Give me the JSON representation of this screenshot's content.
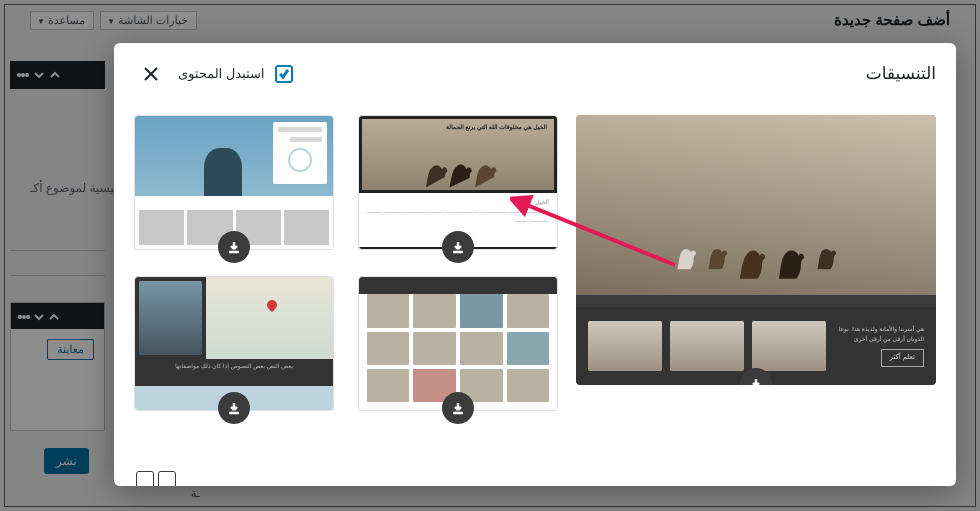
{
  "bg": {
    "page_title": "أضف صفحة جديدة",
    "screen_options": "خيارات الشاشة",
    "help": "مساعدة",
    "placeholder": "…رئيسية لموضوع أكـ",
    "preview": "معاينة",
    "publish": "نشر",
    "bottom_fragment": "ـة"
  },
  "modal": {
    "title": "التنسيقات",
    "replace_label": "استبدل المحتوى",
    "c2_title": "الخيل هي مخلوقات الله التي يرتع الجمالة",
    "c2_sub": "الخيل",
    "c2_lines": "ـــــــــــــ ـــــــــ ـــــــــــ ـــــــ ـــــــــــ ـــ ـــــــ ــــــــــــــ ـــــــــــ ـــــــــ ـــــــــــ ـــــــ",
    "c3_caption": "بعض النص بعض النصوص إذا كان ذلك مواصفاتها",
    "big_text": "هي أسرتنا والأمانة ولذيذة هذا. نوعا الذوبان أرقى من أرقى أخرى",
    "big_cta": "تعلم أكثر"
  }
}
